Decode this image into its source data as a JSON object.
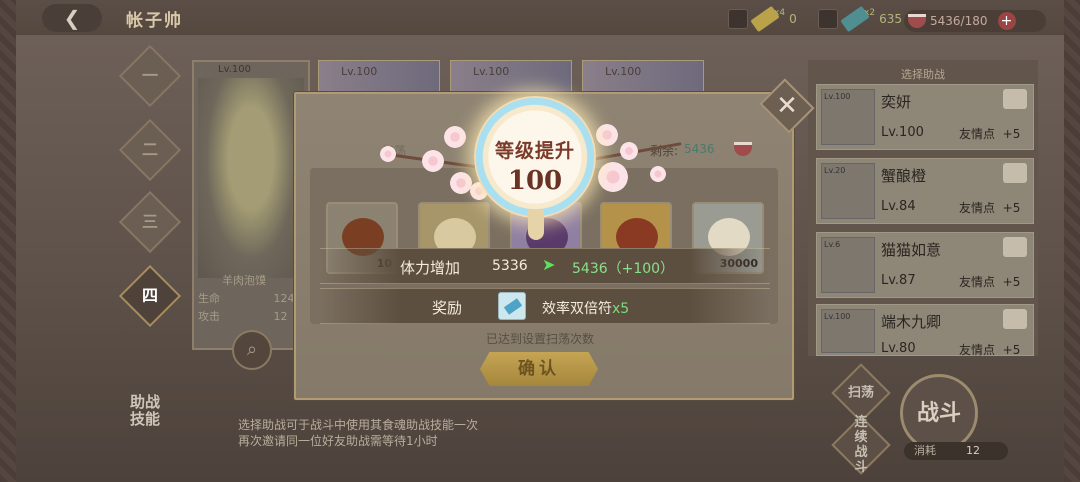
{
  "header": {
    "title": "帐子帅",
    "back_icon": "back-arrow-icon",
    "resources": [
      {
        "name": "gold-ticket",
        "count": "x4",
        "value": "0"
      },
      {
        "name": "teal-ticket",
        "count": "x2",
        "value": "635"
      }
    ],
    "stamina": "5436/180"
  },
  "chapters": [
    "一",
    "二",
    "三",
    "四"
  ],
  "hero_card": {
    "level": "Lv.100",
    "name": "羊肉泡馍",
    "stat_hp_label": "生命",
    "stat_hp_value": "124",
    "stat_atk_label": "攻击",
    "stat_atk_value": "12"
  },
  "card_row": [
    {
      "level": "Lv.100"
    },
    {
      "level": "Lv.100"
    },
    {
      "level": "Lv.100"
    },
    {
      "level": "Lv.100"
    }
  ],
  "helpers": {
    "title": "选择助战",
    "items": [
      {
        "avatar_level": "Lv.100",
        "name": "奕妍",
        "level": "Lv.100",
        "friend_label": "友情点",
        "friend_gain": "+5"
      },
      {
        "avatar_level": "Lv.20",
        "name": "蟹酿橙",
        "level": "Lv.84",
        "friend_label": "友情点",
        "friend_gain": "+5"
      },
      {
        "avatar_level": "Lv.6",
        "name": "猫猫如意",
        "level": "Lv.87",
        "friend_label": "友情点",
        "friend_gain": "+5"
      },
      {
        "avatar_level": "Lv.100",
        "name": "端木九卿",
        "level": "Lv.80",
        "friend_label": "友情点",
        "friend_gain": "+5"
      }
    ]
  },
  "assist_skill_label": "助战\n技能",
  "hint_text": [
    "选择助战可于战斗中使用其食魂助战技能一次",
    "再次邀请同一位好友助战需等待1小时"
  ],
  "buttons": {
    "sweep": "扫荡",
    "continuous": "连续\n战斗",
    "battle": "战斗",
    "cost_label": "消耗",
    "cost_value": "12"
  },
  "modal": {
    "sweep_label": "扫荡",
    "remain_label": "剩余:",
    "remain_value": "5436",
    "level_up_title": "等级提升",
    "level_up_value": "100",
    "items": [
      {
        "qty": "10"
      },
      {
        "qty": ""
      },
      {
        "qty": ""
      },
      {
        "qty": ""
      },
      {
        "qty": "30000"
      }
    ],
    "stamina_label": "体力增加",
    "stamina_old": "5336",
    "stamina_new": "5436（+100）",
    "reward_label": "奖励",
    "reward_name": "效率双倍符",
    "reward_qty": "x5",
    "sweep_done": "已达到设置扫荡次数",
    "confirm": "确认",
    "close_icon": "close-icon"
  },
  "colors": {
    "accent_gold": "#c5a554",
    "stamina_green": "#89e08a",
    "reward_qty_green": "#7bdc78"
  }
}
